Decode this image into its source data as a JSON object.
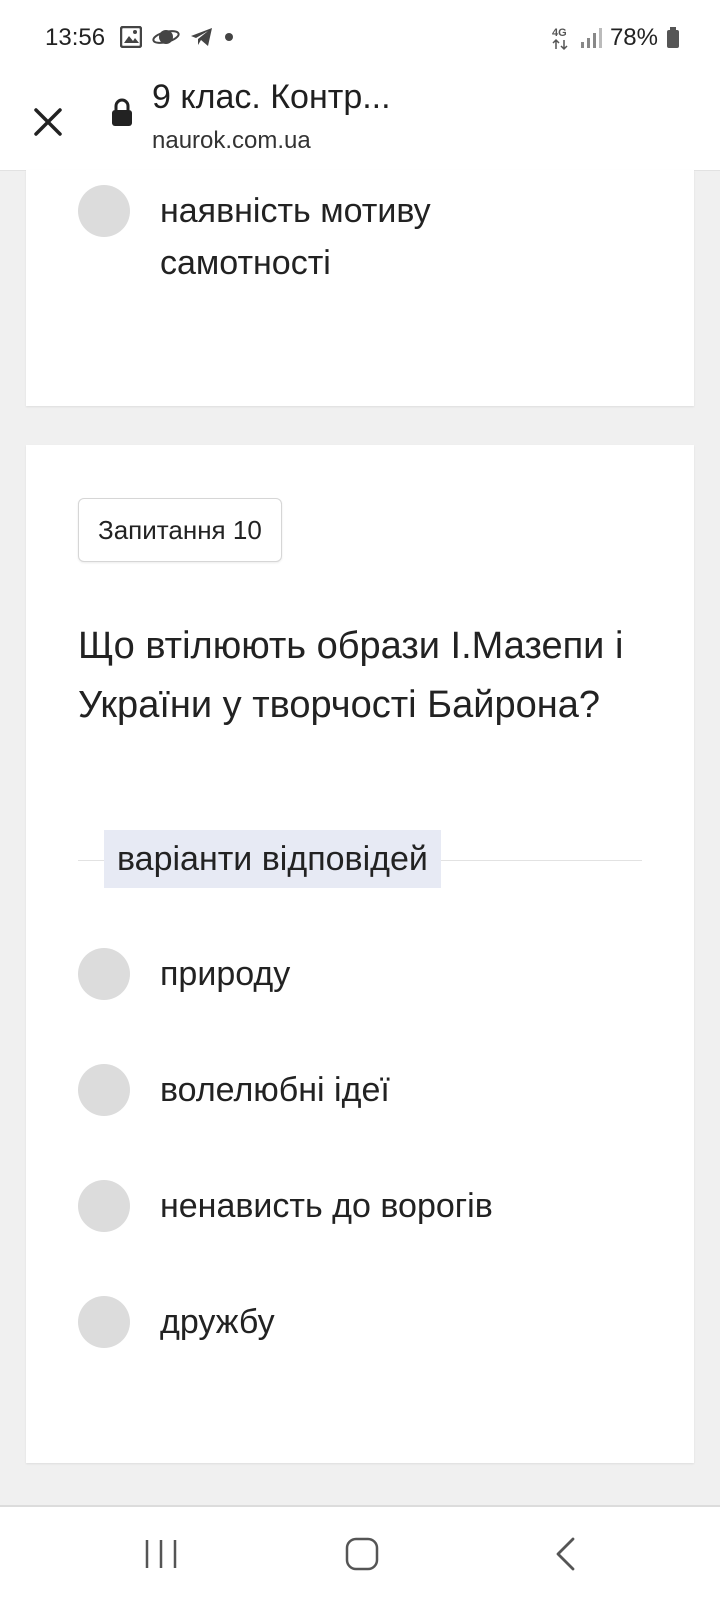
{
  "status_bar": {
    "time": "13:56",
    "network": "4G",
    "battery": "78%",
    "notification_icons": [
      "image-icon",
      "planet-icon",
      "telegram-icon",
      "dot-icon"
    ]
  },
  "toolbar": {
    "title": "9 клас. Контр...",
    "url": "naurok.com.ua"
  },
  "previous_question": {
    "options": [
      {
        "label": "наявність мотиву самотності"
      }
    ]
  },
  "question": {
    "badge": "Запитання 10",
    "text": "Що втілюють образи І.Мазепи і України у творчості Байрона?",
    "answers_label": "варіанти відповідей",
    "options": [
      {
        "label": "природу"
      },
      {
        "label": "волелюбні ідеї"
      },
      {
        "label": "ненависть до ворогів"
      },
      {
        "label": "дружбу"
      }
    ]
  },
  "colors": {
    "background": "#f0f0f0",
    "card": "#ffffff",
    "radio": "#dcdcdc",
    "answers_label_bg": "#e7eaf4"
  }
}
